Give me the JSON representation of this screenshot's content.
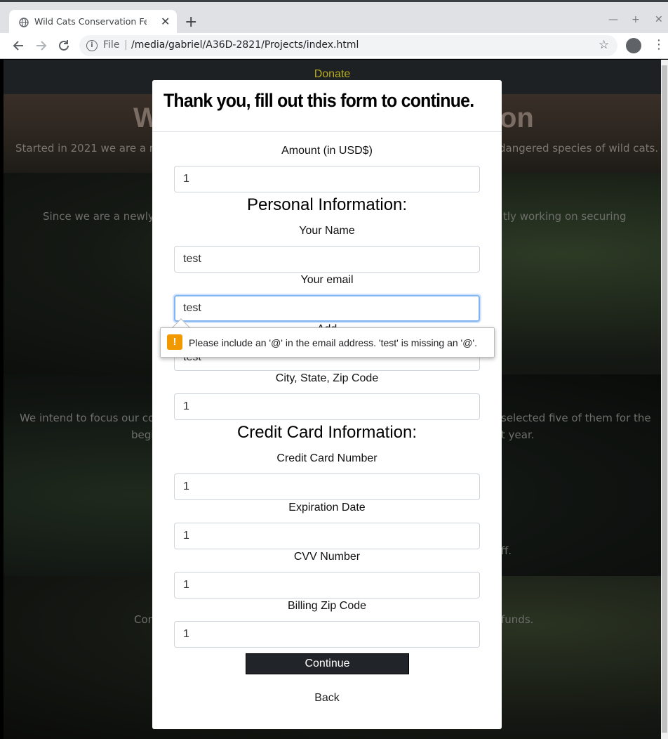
{
  "browser": {
    "tab_title": "Wild Cats Conservation Federation",
    "tab_close": "✕",
    "new_tab": "+",
    "file_label": "File",
    "separator": "|",
    "url": "/media/gabriel/A36D-2821/Projects/index.html",
    "icons": [
      "globe-icon",
      "back-arrow-icon",
      "forward-arrow-icon",
      "reload-icon",
      "info-icon",
      "star-icon",
      "profile-icon",
      "menu-icon"
    ]
  },
  "page": {
    "nav_link": "Donate",
    "hero_title_left": "W",
    "hero_title_right": "on",
    "hero_sub_left": "Started in 2021 we are a ne",
    "hero_sub_right": "dangered species of wild cats.",
    "sec1_left": "Since we are a newly s",
    "sec1_right": "tly working on securing",
    "sec2_line1_left": "We intend to focus our co",
    "sec2_line1_right": "selected five of them for the",
    "sec2_line2_left": "begi",
    "sec2_line2_right": "t year.",
    "sec2_line3_right": "ff.",
    "sec3_left": "Con",
    "sec3_right": "funds."
  },
  "modal": {
    "title": "Thank you, fill out this form to continue.",
    "amount_label": "Amount (in USD$)",
    "amount_value": "1",
    "personal_heading": "Personal Information:",
    "name_label": "Your Name",
    "name_value": "test",
    "email_label": "Your email",
    "email_value": "test",
    "address_label": "Add",
    "address_value": "test",
    "city_label": "City, State, Zip Code",
    "city_value": "1",
    "cc_heading": "Credit Card Information:",
    "cc_number_label": "Credit Card Number",
    "cc_number_value": "1",
    "expiration_label": "Expiration Date",
    "expiration_value": "1",
    "cvv_label": "CVV Number",
    "cvv_value": "1",
    "billing_zip_label": "Billing Zip Code",
    "billing_zip_value": "1",
    "continue_label": "Continue",
    "back_label": "Back"
  },
  "validation": {
    "icon": "!",
    "message": "Please include an '@' in the email address. 'test' is missing an '@'."
  },
  "colors": {
    "accent_link": "#b6ab1c",
    "warning": "#f29900",
    "button_bg": "#212529"
  }
}
